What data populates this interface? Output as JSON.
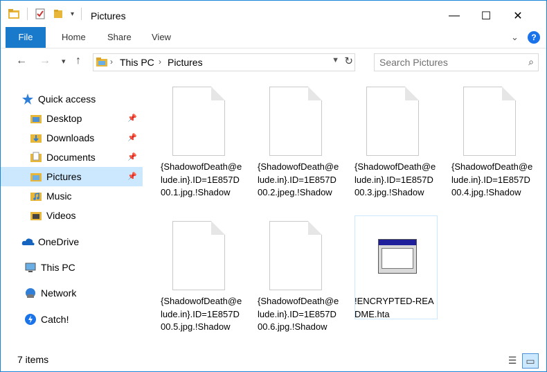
{
  "window": {
    "title": "Pictures"
  },
  "window_controls": {
    "minimize": "—",
    "maximize": "☐",
    "close": "✕"
  },
  "ribbon": {
    "tabs": [
      "File",
      "Home",
      "Share",
      "View"
    ]
  },
  "address": {
    "crumbs": [
      "This PC",
      "Pictures"
    ]
  },
  "search": {
    "placeholder": "Search Pictures"
  },
  "nav": {
    "quick_access": "Quick access",
    "items": [
      {
        "label": "Desktop",
        "pinned": true
      },
      {
        "label": "Downloads",
        "pinned": true
      },
      {
        "label": "Documents",
        "pinned": true
      },
      {
        "label": "Pictures",
        "pinned": true,
        "selected": true
      },
      {
        "label": "Music",
        "pinned": false
      },
      {
        "label": "Videos",
        "pinned": false
      }
    ],
    "onedrive": "OneDrive",
    "this_pc": "This PC",
    "network": "Network",
    "catch": "Catch!"
  },
  "files": [
    {
      "name": "{ShadowofDeath@elude.in}.ID=1E857D00.1.jpg.!Shadow",
      "type": "blank"
    },
    {
      "name": "{ShadowofDeath@elude.in}.ID=1E857D00.2.jpeg.!Shadow",
      "type": "blank"
    },
    {
      "name": "{ShadowofDeath@elude.in}.ID=1E857D00.3.jpg.!Shadow",
      "type": "blank"
    },
    {
      "name": "{ShadowofDeath@elude.in}.ID=1E857D00.4.jpg.!Shadow",
      "type": "blank"
    },
    {
      "name": "{ShadowofDeath@elude.in}.ID=1E857D00.5.jpg.!Shadow",
      "type": "blank"
    },
    {
      "name": "{ShadowofDeath@elude.in}.ID=1E857D00.6.jpg.!Shadow",
      "type": "blank"
    },
    {
      "name": "!ENCRYPTED-README.hta",
      "type": "hta"
    }
  ],
  "status": {
    "count": "7 items"
  },
  "colors": {
    "accent": "#1979ca",
    "selected": "#cce8ff",
    "border": "#1883d7"
  }
}
